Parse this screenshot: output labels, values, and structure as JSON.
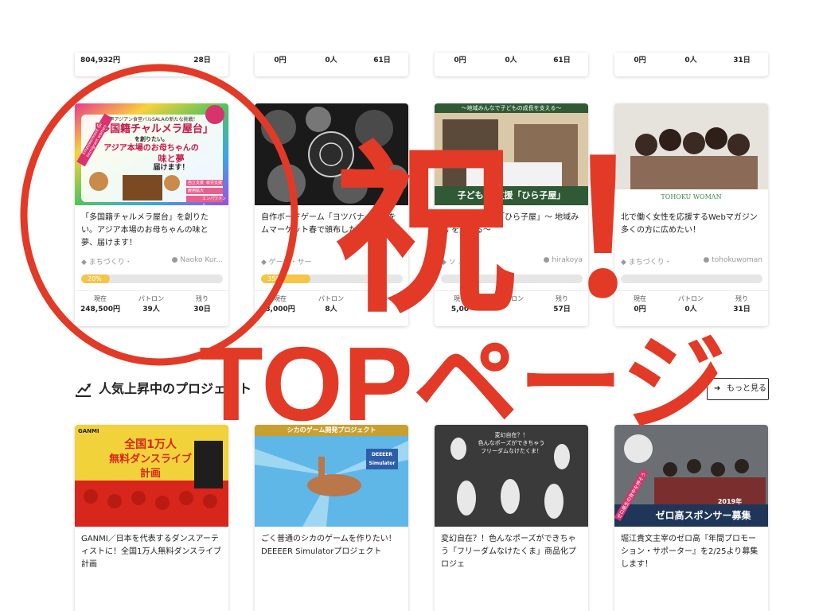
{
  "stat_labels": {
    "current": "現在",
    "patrons": "パトロン",
    "remaining": "残り"
  },
  "top_row": [
    {
      "current": "804,932円",
      "patrons": "",
      "remaining": "28日"
    },
    {
      "current": "0円",
      "patrons": "0人",
      "remaining": "61日"
    },
    {
      "current": "0円",
      "patrons": "0人",
      "remaining": "61日"
    },
    {
      "current": "0円",
      "patrons": "0人",
      "remaining": "31日"
    }
  ],
  "projects": [
    {
      "title": "「多国籍チャルメラ屋台」を創りたい。アジア本場のお母ちゃんの味と夢、届けます！",
      "category": "まちづくり・",
      "owner": "Naoko Kur...",
      "progress_percent": 20,
      "progress_label": "20%",
      "current": "248,500円",
      "patrons": "39人",
      "remaining": "30日",
      "thumb": {
        "line1": "神戸アジアン食堂バルSALAの新たな挑戦！",
        "line2": "「多国籍チャルメラ屋台」",
        "line3": "を創りたい。",
        "line4": "アジア本場のお母ちゃんの",
        "line5": "味と夢",
        "line6": "届けます！",
        "side": "Empowerment for Immigrant women",
        "tags": [
          "自立支援",
          "就労支援",
          "雇用拡大",
          "エンパワメント"
        ]
      }
    },
    {
      "title": "自作ボードゲーム「ヨツバナイツ」を ムマーケット春で頒布したい",
      "category": "ゲーム・サー",
      "owner": "",
      "progress_percent": 35,
      "progress_label": "35%",
      "current": "8,000円",
      "patrons": "8人",
      "remaining": "",
      "thumb": {}
    },
    {
      "title": "子ども学習支援「ひら子屋」〜 地域みん を支える〜",
      "category": "ソ ルグ",
      "owner": "hirakoya",
      "progress_percent": 0,
      "progress_label": "",
      "current": "5,00",
      "patrons": "",
      "remaining": "57日",
      "thumb": {
        "banner": "〜地域みんなで子どもの成長を支える〜",
        "caption": "子ども学 支援「ひら子屋」"
      }
    },
    {
      "title": "北で働く女性を応援するWebマガジン 多くの方に広めたい！",
      "category": "まちづくり・",
      "owner": "tohokuwoman",
      "progress_percent": 0,
      "progress_label": "",
      "current": "0円",
      "patrons": "0人",
      "remaining": "31日",
      "thumb": {
        "caption": "TOHOKU WOMAN"
      }
    }
  ],
  "section": {
    "title": "人気上昇中のプロジェクト",
    "more_button": "もっと見る"
  },
  "bottom_projects": [
    {
      "title": "GANMI／日本を代表するダンスアーティストに！全国1万人無料ダンスライブ計画",
      "thumb": {
        "logo": "GANMI",
        "line1": "全国1万人",
        "line2": "無料ダンスライブ",
        "line3": "計画"
      }
    },
    {
      "title": "ごく普通のシカのゲームを作りたい！ DEEEER Simulatorプロジェクト",
      "thumb": {
        "banner": "シカのゲーム開発プロジェクト",
        "logo": "DEEEER Simulator"
      }
    },
    {
      "title": "変幻自在？！色んなポーズができちゃう「フリーダムなけたくま」商品化プロジェ",
      "thumb": {
        "line1": "変幻自在？！",
        "line2": "色んなポーズができちゃう",
        "line3": "フリーダムなけたくま！"
      }
    },
    {
      "title": "堀江貴文主宰のゼロ高『年間プロモーション・サポーター』を2/25より募集します！",
      "thumb": {
        "year": "2019年",
        "caption": "ゼロ高スポンサー募集",
        "side": "ゼロ高生の背中を押そう"
      }
    }
  ],
  "overlay": {
    "kanji": "祝",
    "exclaim": "！",
    "headline": "TOPページ"
  },
  "colors": {
    "overlay_red": "#e23a27",
    "progress_yellow": "#f4c548",
    "progress_track": "#e6e6e6"
  }
}
